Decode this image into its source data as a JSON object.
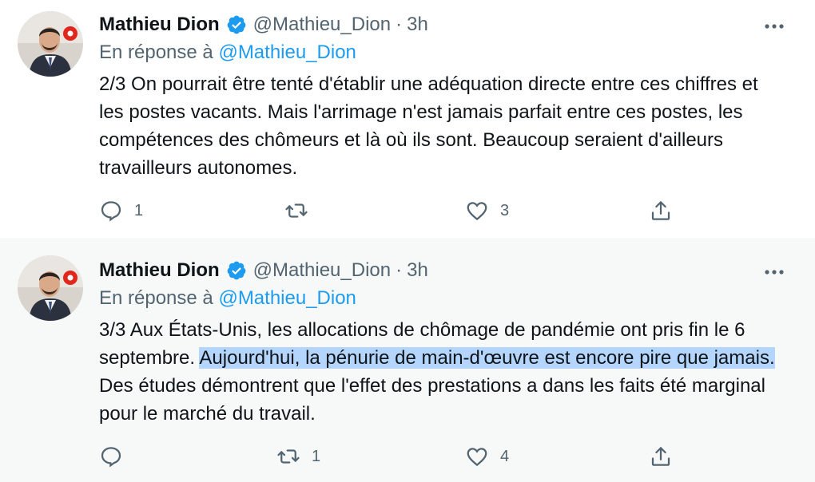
{
  "tweets": [
    {
      "author": "Mathieu Dion",
      "handle": "@Mathieu_Dion",
      "dot": "·",
      "time": "3h",
      "reply_prefix": "En réponse à",
      "reply_mention": "@Mathieu_Dion",
      "text_plain": "2/3 On pourrait être tenté d'établir une adéquation directe entre ces chiffres et les postes vacants. Mais l'arrimage n'est jamais parfait entre ces postes, les compétences des chômeurs et là où ils sont. Beaucoup seraient d'ailleurs travailleurs autonomes.",
      "reply_count": "1",
      "retweet_count": "",
      "like_count": "3"
    },
    {
      "author": "Mathieu Dion",
      "handle": "@Mathieu_Dion",
      "dot": "·",
      "time": "3h",
      "reply_prefix": "En réponse à",
      "reply_mention": "@Mathieu_Dion",
      "text_before": "3/3 Aux États-Unis, les allocations de chômage de pandémie ont pris fin le 6 septembre. ",
      "text_highlight": "Aujourd'hui, la pénurie de main-d'œuvre est encore pire que jamais.",
      "text_after": " Des études démontrent que l'effet des prestations a dans les faits été marginal pour le marché du travail.",
      "reply_count": "",
      "retweet_count": "1",
      "like_count": "4"
    }
  ],
  "colors": {
    "verified": "#1d9bf0",
    "mention": "#1d9bf0",
    "secondary_text": "#536471",
    "highlight": "#b4d5fe"
  },
  "icons": [
    "verified-badge-icon",
    "more-icon",
    "reply-icon",
    "retweet-icon",
    "like-icon",
    "share-icon"
  ]
}
